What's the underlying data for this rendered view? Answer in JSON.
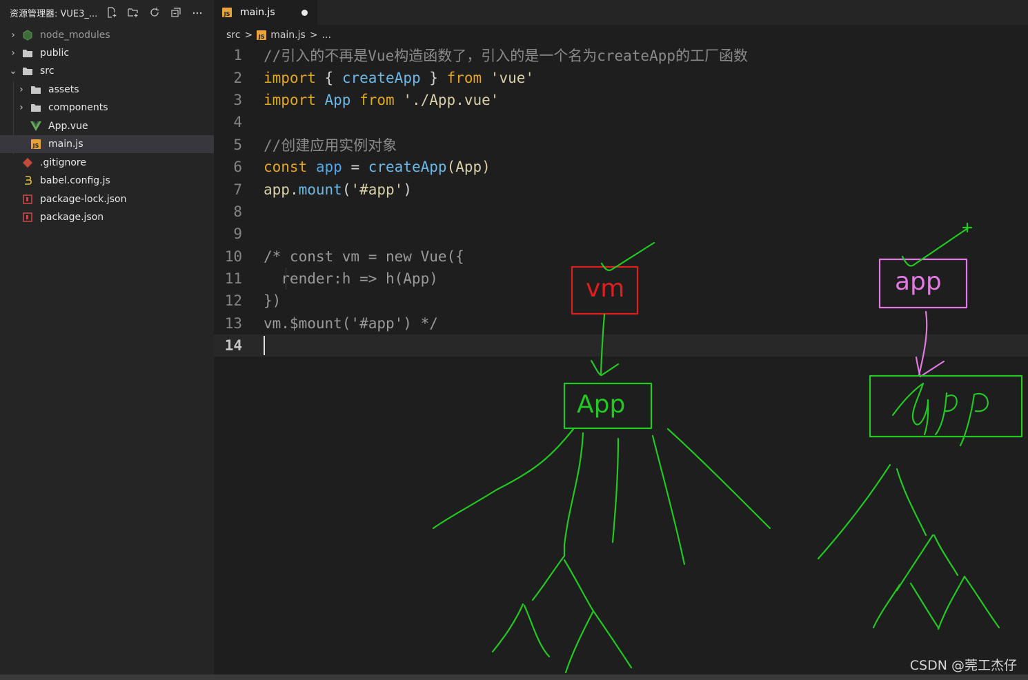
{
  "explorer": {
    "title": "资源管理器: VUE3_...",
    "tree": [
      {
        "label": "node_modules",
        "icon": "node-modules-folder-icon",
        "chevron": "›",
        "depth": 0
      },
      {
        "label": "public",
        "icon": "folder-icon",
        "chevron": "›",
        "depth": 0
      },
      {
        "label": "src",
        "icon": "folder-open-icon",
        "chevron": "⌄",
        "depth": 0
      },
      {
        "label": "assets",
        "icon": "folder-icon",
        "chevron": "›",
        "depth": 1
      },
      {
        "label": "components",
        "icon": "folder-icon",
        "chevron": "›",
        "depth": 1
      },
      {
        "label": "App.vue",
        "icon": "vue-file-icon",
        "chevron": "",
        "depth": 1
      },
      {
        "label": "main.js",
        "icon": "js-file-icon",
        "chevron": "",
        "depth": 1
      },
      {
        "label": ".gitignore",
        "icon": "git-file-icon",
        "chevron": "",
        "depth": 0
      },
      {
        "label": "babel.config.js",
        "icon": "babel-file-icon",
        "chevron": "",
        "depth": 0
      },
      {
        "label": "package-lock.json",
        "icon": "json-file-icon",
        "chevron": "",
        "depth": 0
      },
      {
        "label": "package.json",
        "icon": "json-file-icon",
        "chevron": "",
        "depth": 0
      }
    ]
  },
  "tab": {
    "label": "main.js",
    "icon_text": "JS"
  },
  "breadcrumb": {
    "folder": "src",
    "sep": ">",
    "file": "main.js",
    "more": "..."
  },
  "code": {
    "lines": [
      {
        "n": "1",
        "text": "//引入的不再是Vue构造函数了，引入的是一个名为createApp的工厂函数"
      },
      {
        "n": "2"
      },
      {
        "n": "3"
      },
      {
        "n": "4"
      },
      {
        "n": "5",
        "text": "//创建应用实例对象"
      },
      {
        "n": "6"
      },
      {
        "n": "7"
      },
      {
        "n": "8"
      },
      {
        "n": "9"
      },
      {
        "n": "10",
        "text": "/* const vm = new Vue({"
      },
      {
        "n": "11",
        "text": "  render:h => h(App)"
      },
      {
        "n": "12",
        "text": "})"
      },
      {
        "n": "13",
        "text": "vm.$mount('#app') */"
      },
      {
        "n": "14"
      }
    ],
    "tokens": {
      "import": "import",
      "from": "from",
      "const": "const",
      "l2_open": "{ ",
      "l2_createApp": "createApp",
      "l2_close": " }",
      "l2_vue": "'vue'",
      "l3_App": "App",
      "l3_path": "'./App.vue'",
      "l6_app": "app",
      "l6_eq": " = ",
      "l6_createApp": "createApp",
      "l6_args": "(App)",
      "l7_app": "app",
      "l7_dot": ".",
      "l7_mount": "mount",
      "l7_open": "(",
      "l7_str": "'#app'",
      "l7_close": ")"
    }
  },
  "annotations": {
    "vm": "vm",
    "app_left": "App",
    "app_right_top": "app",
    "colors": {
      "red": "#e01e1e",
      "green": "#22c922",
      "pink": "#e27ae2"
    }
  },
  "watermark": "CSDN @莞工杰仔"
}
